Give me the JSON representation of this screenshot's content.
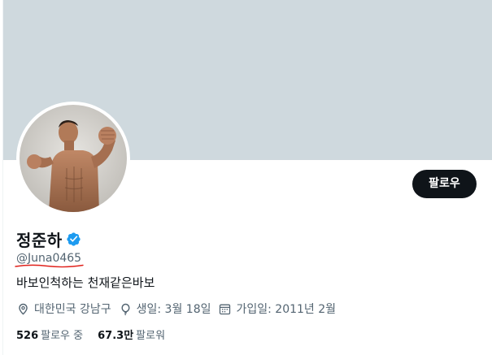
{
  "profile": {
    "display_name": "정준하",
    "handle": "@Juna0465",
    "bio": "바보인척하는 천재같은바보",
    "verified": true,
    "follow_button": "팔로우",
    "banner_color": "#cfd9de",
    "verified_color": "#1d9bf0",
    "handle_underline_color": "#e0201a"
  },
  "meta": {
    "location": "대한민국 강남구",
    "location_icon": "location-pin-icon",
    "birthday": "생일: 3월 18일",
    "birthday_icon": "balloon-icon",
    "joined": "가입일: 2011년 2월",
    "joined_icon": "calendar-icon"
  },
  "stats": {
    "following_count": "526",
    "following_label": "팔로우 중",
    "followers_count": "67.3만",
    "followers_label": "팔로워"
  }
}
